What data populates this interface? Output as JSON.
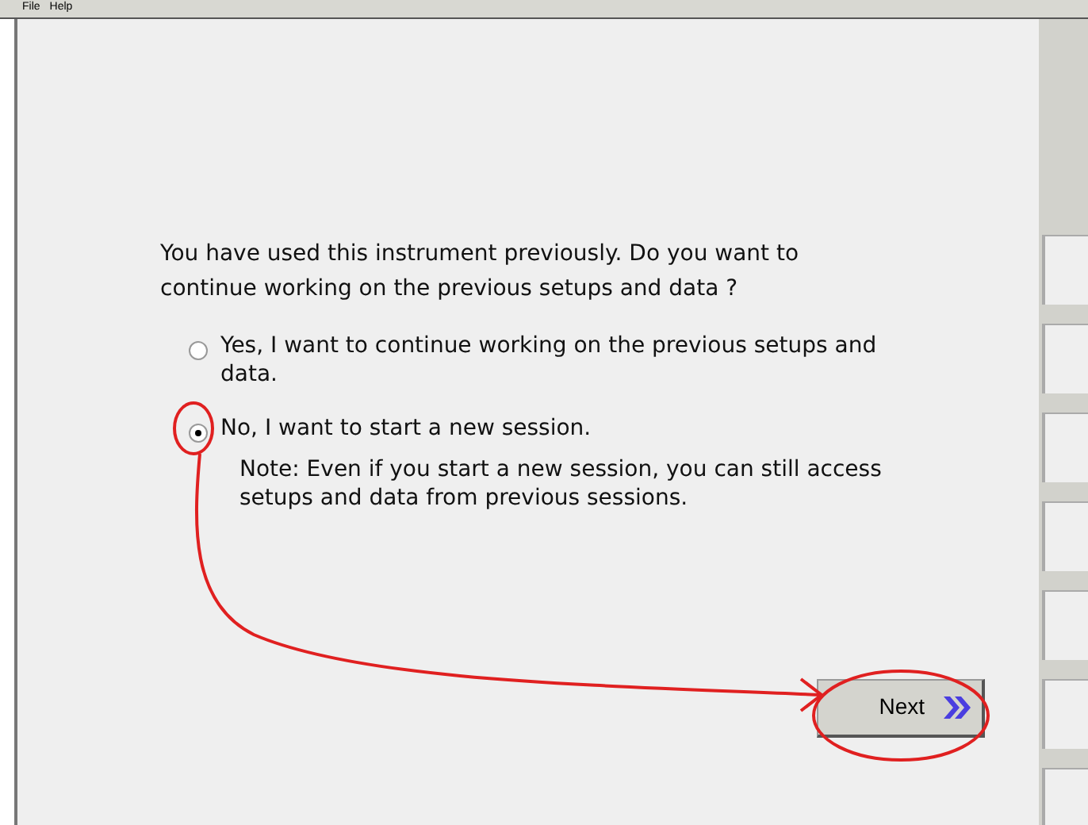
{
  "menu": [
    "File",
    "Help"
  ],
  "question": "You have used this instrument previously. Do you want to continue working on the previous setups and data ?",
  "options": [
    {
      "label": "Yes, I want to continue working on the previous setups and data.",
      "selected": false
    },
    {
      "label": "No, I want to start a new session.",
      "selected": true,
      "note": "Note: Even if you start a new session, you can still access setups and data from previous sessions."
    }
  ],
  "next_button": {
    "label": "Next"
  }
}
